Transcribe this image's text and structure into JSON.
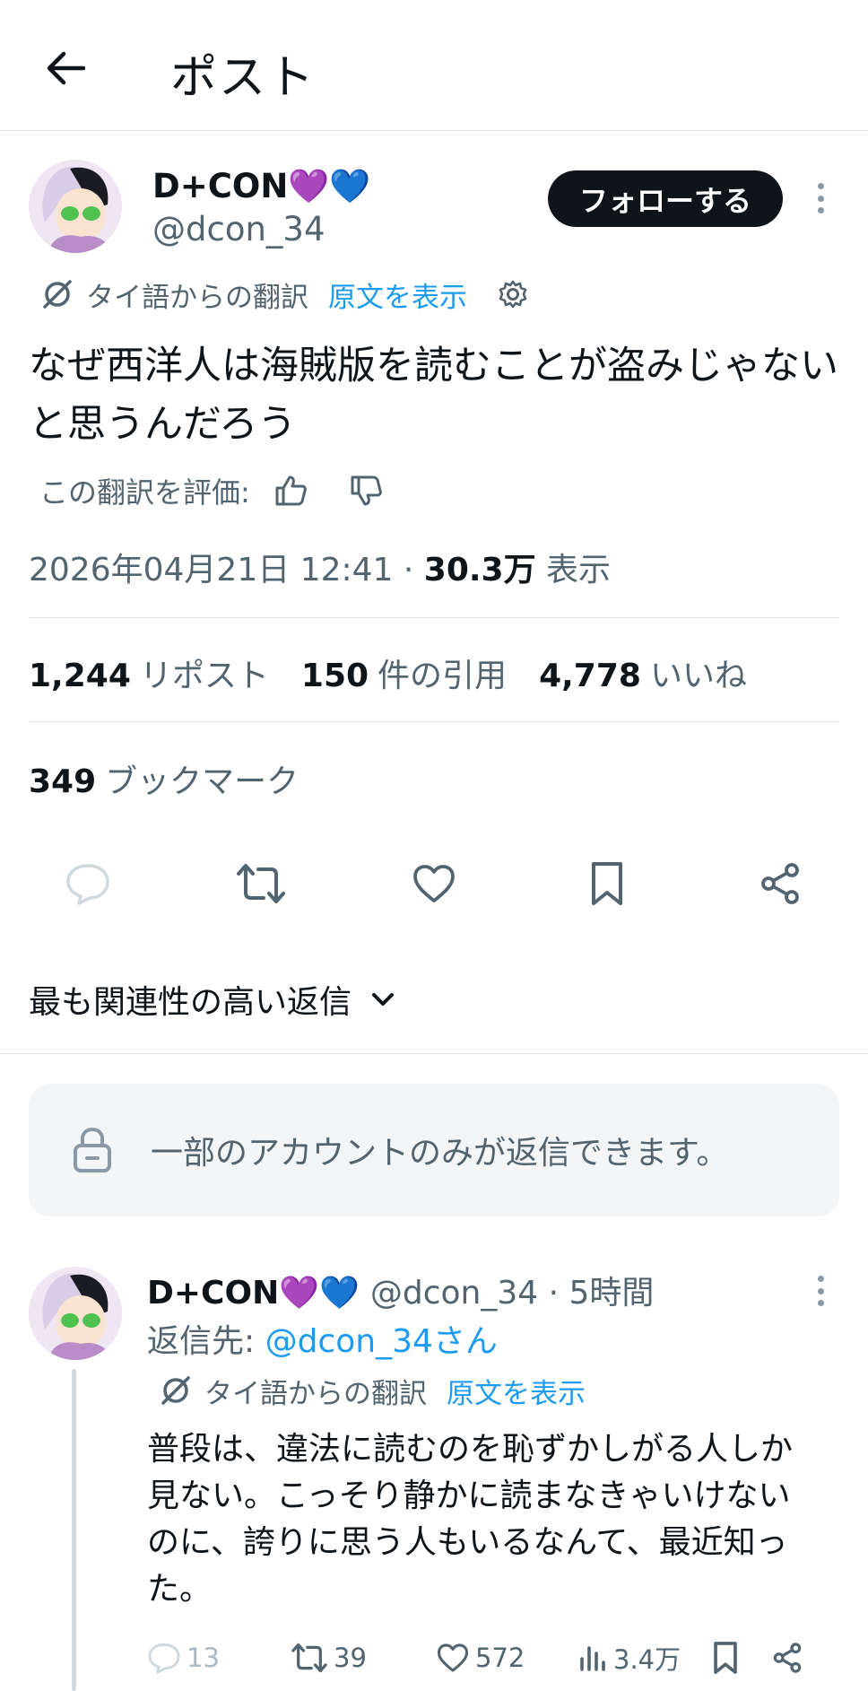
{
  "header": {
    "title": "ポスト"
  },
  "post": {
    "author_name": "D+CON💜💙",
    "author_handle": "@dcon_34",
    "follow_label": "フォローする",
    "translation_note": "タイ語からの翻訳",
    "show_original": "原文を表示",
    "text": "なぜ西洋人は海賊版を読むことが盗みじゃないと思うんだろう",
    "rate_label": "この翻訳を評価:",
    "timestamp": "2026年04月21日 12:41 · ",
    "views_count": "30.3万",
    "views_label": " 表示",
    "reposts_count": "1,244",
    "reposts_label": "リポスト",
    "quotes_count": "150",
    "quotes_label": "件の引用",
    "likes_count": "4,778",
    "likes_label": "いいね",
    "bookmarks_count": "349",
    "bookmarks_label": "ブックマーク"
  },
  "sort": {
    "label": "最も関連性の高い返信"
  },
  "notice": {
    "text": "一部のアカウントのみが返信できます。"
  },
  "reply": {
    "author_name": "D+CON💜💙",
    "meta": "@dcon_34 · 5時間",
    "reply_to_label": "返信先: ",
    "reply_to_handle": "@dcon_34さん",
    "translation_note": "タイ語からの翻訳",
    "show_original": "原文を表示",
    "text": "普段は、違法に読むのを恥ずかしがる人しか見ない。こっそり静かに読まなきゃいけないのに、誇りに思う人もいるなんて、最近知った。",
    "replies": "13",
    "reposts": "39",
    "likes": "572",
    "views": "3.4万"
  },
  "colors": {
    "accent": "#1d9bf0",
    "text": "#0f1419",
    "muted": "#536471"
  }
}
